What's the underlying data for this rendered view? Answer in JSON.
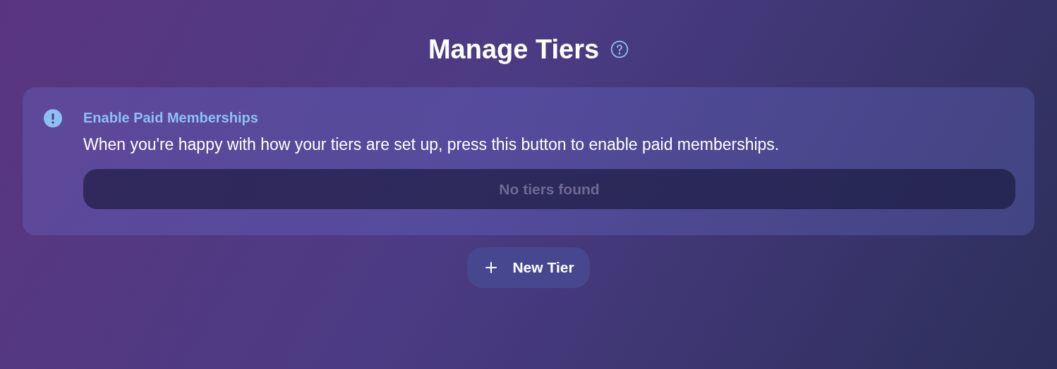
{
  "header": {
    "title": "Manage Tiers"
  },
  "alert": {
    "title": "Enable Paid Memberships",
    "message": "When you're happy with how your tiers are set up, press this button to enable paid memberships.",
    "button": {
      "label": "No tiers found",
      "disabled": true
    }
  },
  "new_tier_button": {
    "label": "New Tier"
  }
}
